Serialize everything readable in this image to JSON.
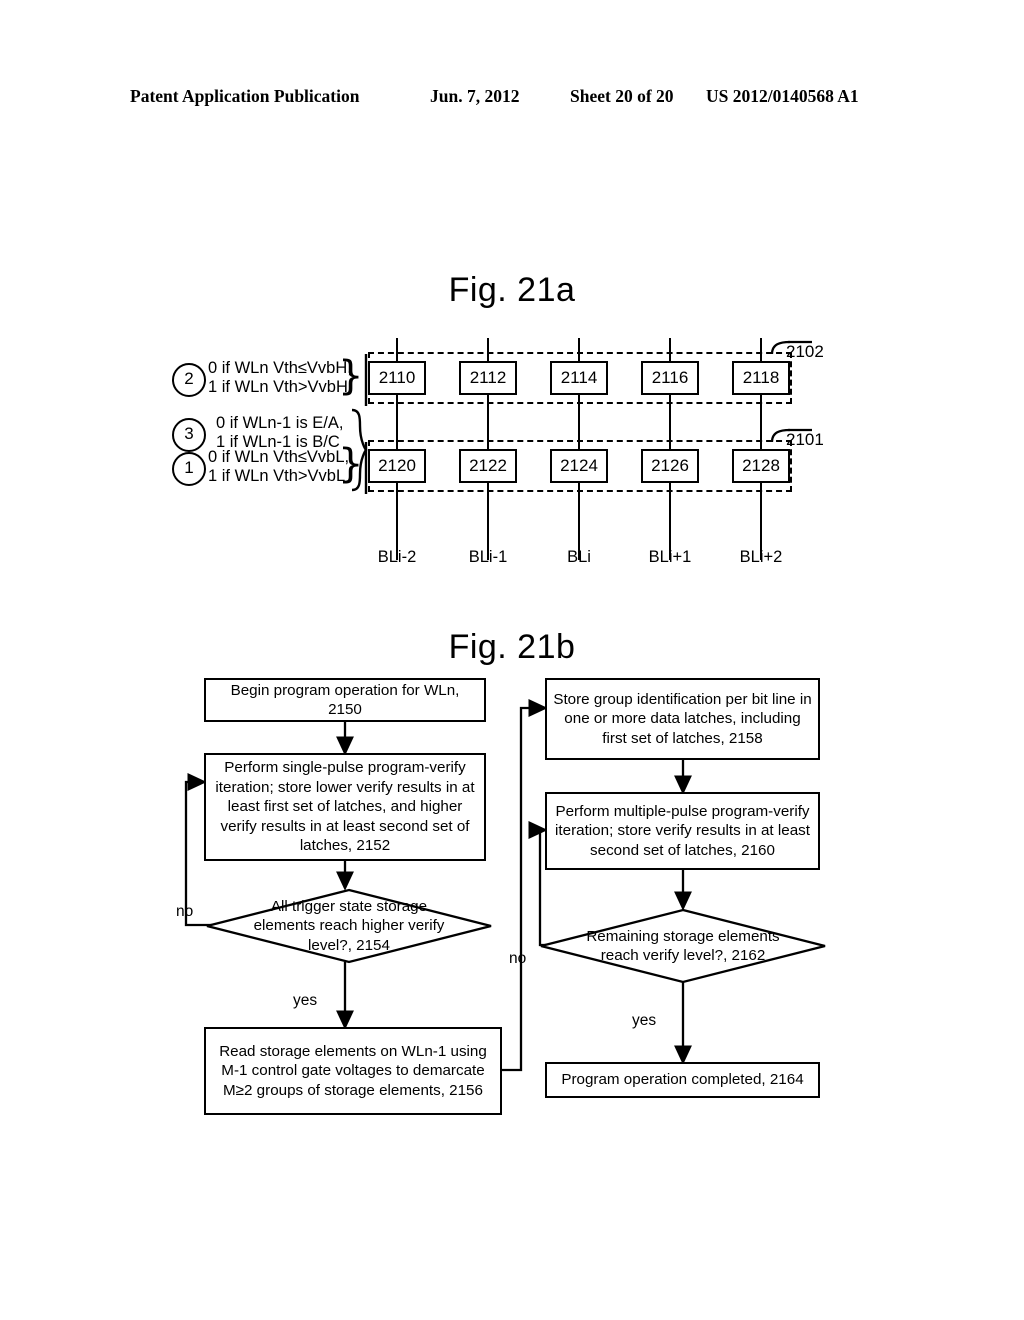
{
  "header": {
    "publication": "Patent Application Publication",
    "date": "Jun. 7, 2012",
    "sheet": "Sheet 20 of 20",
    "number": "US 2012/0140568 A1"
  },
  "fig21a": {
    "title": "Fig. 21a",
    "annotations": [
      {
        "circle": "2",
        "line1": "0 if WLn Vth≤VvbH,",
        "line2": "1 if WLn Vth>VvbH"
      },
      {
        "circle": "3",
        "line1": "0 if WLn-1 is E/A,",
        "line2": "1 if WLn-1 is B/C"
      },
      {
        "circle": "1",
        "line1": "0 if WLn Vth≤VvbL,",
        "line2": "1 if WLn Vth>VvbL"
      }
    ],
    "top_latches": [
      "2110",
      "2112",
      "2114",
      "2116",
      "2118"
    ],
    "bottom_latches": [
      "2120",
      "2122",
      "2124",
      "2126",
      "2128"
    ],
    "bitlines": [
      "BLi-2",
      "BLi-1",
      "BLi",
      "BLi+1",
      "BLi+2"
    ],
    "group_top_ref": "2102",
    "group_bottom_ref": "2101"
  },
  "fig21b": {
    "title": "Fig. 21b",
    "boxes": {
      "b2150": "Begin program operation for WLn, 2150",
      "b2152": "Perform single-pulse program-verify iteration; store lower verify results in at least first set of latches, and higher verify results in at least second set of latches, 2152",
      "d2154": "All trigger state storage elements reach higher verify level?, 2154",
      "b2156": "Read storage elements on WLn-1 using M-1 control gate voltages to demarcate M≥2 groups of storage elements, 2156",
      "b2158": "Store group identification per bit line in one or more data latches, including first set of latches, 2158",
      "b2160": "Perform multiple-pulse program-verify iteration; store verify results in at least second set of latches, 2160",
      "d2162": "Remaining storage elements reach verify level?, 2162",
      "b2164": "Program operation completed, 2164"
    },
    "edges": {
      "no_2154": "no",
      "yes_2154": "yes",
      "no_2162": "no",
      "yes_2162": "yes"
    }
  }
}
